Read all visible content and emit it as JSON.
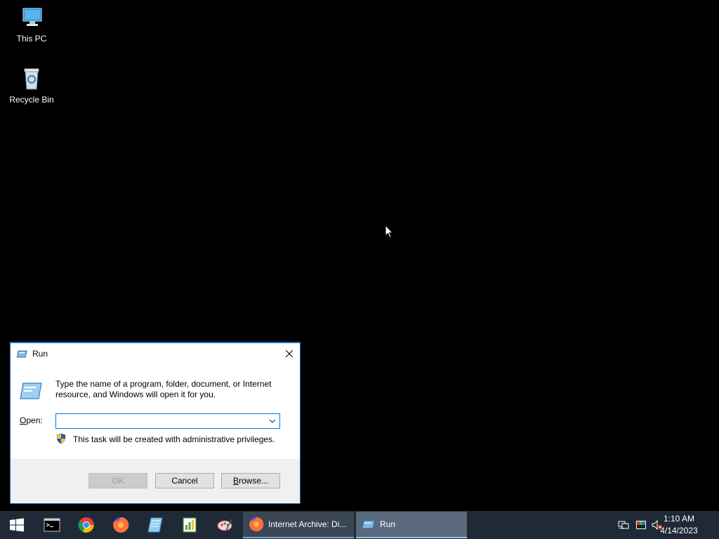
{
  "desktop": {
    "icons": [
      {
        "label": "This PC",
        "icon": "this-pc-icon"
      },
      {
        "label": "Recycle Bin",
        "icon": "recycle-bin-icon"
      }
    ]
  },
  "run_dialog": {
    "title": "Run",
    "description": "Type the name of a program, folder, document, or Internet resource, and Windows will open it for you.",
    "open_label_accel": "O",
    "open_label_rest": "pen:",
    "open_value": "",
    "admin_note": "This task will be created with administrative privileges.",
    "ok_label": "OK",
    "cancel_label": "Cancel",
    "browse_label_accel": "B",
    "browse_label_rest": "rowse...",
    "accent": "#0078d7"
  },
  "taskbar": {
    "pinned": [
      "start-icon",
      "command-prompt-icon",
      "chrome-icon",
      "firefox-icon",
      "notepad-icon",
      "spreadsheet-icon",
      "paint-icon"
    ],
    "apps": [
      {
        "label": "Internet Archive: Di...",
        "icon": "firefox-icon"
      },
      {
        "label": "Run",
        "icon": "run-icon"
      }
    ],
    "tray": [
      "network-icon",
      "color-icon",
      "volume-muted-icon"
    ],
    "time": "1:10 AM",
    "date": "4/14/2023"
  }
}
